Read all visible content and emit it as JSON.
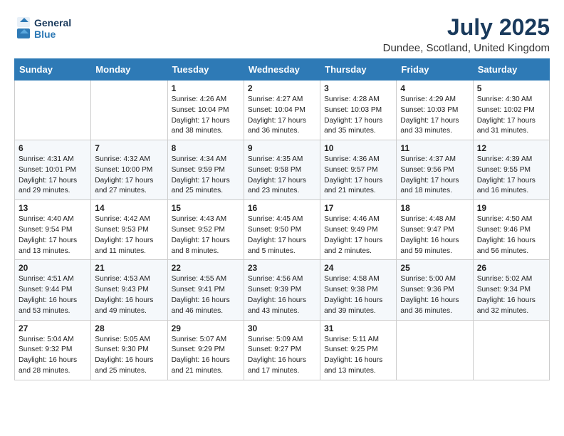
{
  "header": {
    "logo_line1": "General",
    "logo_line2": "Blue",
    "month_year": "July 2025",
    "location": "Dundee, Scotland, United Kingdom"
  },
  "days_of_week": [
    "Sunday",
    "Monday",
    "Tuesday",
    "Wednesday",
    "Thursday",
    "Friday",
    "Saturday"
  ],
  "weeks": [
    [
      {
        "day": "",
        "info": ""
      },
      {
        "day": "",
        "info": ""
      },
      {
        "day": "1",
        "info": "Sunrise: 4:26 AM\nSunset: 10:04 PM\nDaylight: 17 hours and 38 minutes."
      },
      {
        "day": "2",
        "info": "Sunrise: 4:27 AM\nSunset: 10:04 PM\nDaylight: 17 hours and 36 minutes."
      },
      {
        "day": "3",
        "info": "Sunrise: 4:28 AM\nSunset: 10:03 PM\nDaylight: 17 hours and 35 minutes."
      },
      {
        "day": "4",
        "info": "Sunrise: 4:29 AM\nSunset: 10:03 PM\nDaylight: 17 hours and 33 minutes."
      },
      {
        "day": "5",
        "info": "Sunrise: 4:30 AM\nSunset: 10:02 PM\nDaylight: 17 hours and 31 minutes."
      }
    ],
    [
      {
        "day": "6",
        "info": "Sunrise: 4:31 AM\nSunset: 10:01 PM\nDaylight: 17 hours and 29 minutes."
      },
      {
        "day": "7",
        "info": "Sunrise: 4:32 AM\nSunset: 10:00 PM\nDaylight: 17 hours and 27 minutes."
      },
      {
        "day": "8",
        "info": "Sunrise: 4:34 AM\nSunset: 9:59 PM\nDaylight: 17 hours and 25 minutes."
      },
      {
        "day": "9",
        "info": "Sunrise: 4:35 AM\nSunset: 9:58 PM\nDaylight: 17 hours and 23 minutes."
      },
      {
        "day": "10",
        "info": "Sunrise: 4:36 AM\nSunset: 9:57 PM\nDaylight: 17 hours and 21 minutes."
      },
      {
        "day": "11",
        "info": "Sunrise: 4:37 AM\nSunset: 9:56 PM\nDaylight: 17 hours and 18 minutes."
      },
      {
        "day": "12",
        "info": "Sunrise: 4:39 AM\nSunset: 9:55 PM\nDaylight: 17 hours and 16 minutes."
      }
    ],
    [
      {
        "day": "13",
        "info": "Sunrise: 4:40 AM\nSunset: 9:54 PM\nDaylight: 17 hours and 13 minutes."
      },
      {
        "day": "14",
        "info": "Sunrise: 4:42 AM\nSunset: 9:53 PM\nDaylight: 17 hours and 11 minutes."
      },
      {
        "day": "15",
        "info": "Sunrise: 4:43 AM\nSunset: 9:52 PM\nDaylight: 17 hours and 8 minutes."
      },
      {
        "day": "16",
        "info": "Sunrise: 4:45 AM\nSunset: 9:50 PM\nDaylight: 17 hours and 5 minutes."
      },
      {
        "day": "17",
        "info": "Sunrise: 4:46 AM\nSunset: 9:49 PM\nDaylight: 17 hours and 2 minutes."
      },
      {
        "day": "18",
        "info": "Sunrise: 4:48 AM\nSunset: 9:47 PM\nDaylight: 16 hours and 59 minutes."
      },
      {
        "day": "19",
        "info": "Sunrise: 4:50 AM\nSunset: 9:46 PM\nDaylight: 16 hours and 56 minutes."
      }
    ],
    [
      {
        "day": "20",
        "info": "Sunrise: 4:51 AM\nSunset: 9:44 PM\nDaylight: 16 hours and 53 minutes."
      },
      {
        "day": "21",
        "info": "Sunrise: 4:53 AM\nSunset: 9:43 PM\nDaylight: 16 hours and 49 minutes."
      },
      {
        "day": "22",
        "info": "Sunrise: 4:55 AM\nSunset: 9:41 PM\nDaylight: 16 hours and 46 minutes."
      },
      {
        "day": "23",
        "info": "Sunrise: 4:56 AM\nSunset: 9:39 PM\nDaylight: 16 hours and 43 minutes."
      },
      {
        "day": "24",
        "info": "Sunrise: 4:58 AM\nSunset: 9:38 PM\nDaylight: 16 hours and 39 minutes."
      },
      {
        "day": "25",
        "info": "Sunrise: 5:00 AM\nSunset: 9:36 PM\nDaylight: 16 hours and 36 minutes."
      },
      {
        "day": "26",
        "info": "Sunrise: 5:02 AM\nSunset: 9:34 PM\nDaylight: 16 hours and 32 minutes."
      }
    ],
    [
      {
        "day": "27",
        "info": "Sunrise: 5:04 AM\nSunset: 9:32 PM\nDaylight: 16 hours and 28 minutes."
      },
      {
        "day": "28",
        "info": "Sunrise: 5:05 AM\nSunset: 9:30 PM\nDaylight: 16 hours and 25 minutes."
      },
      {
        "day": "29",
        "info": "Sunrise: 5:07 AM\nSunset: 9:29 PM\nDaylight: 16 hours and 21 minutes."
      },
      {
        "day": "30",
        "info": "Sunrise: 5:09 AM\nSunset: 9:27 PM\nDaylight: 16 hours and 17 minutes."
      },
      {
        "day": "31",
        "info": "Sunrise: 5:11 AM\nSunset: 9:25 PM\nDaylight: 16 hours and 13 minutes."
      },
      {
        "day": "",
        "info": ""
      },
      {
        "day": "",
        "info": ""
      }
    ]
  ]
}
